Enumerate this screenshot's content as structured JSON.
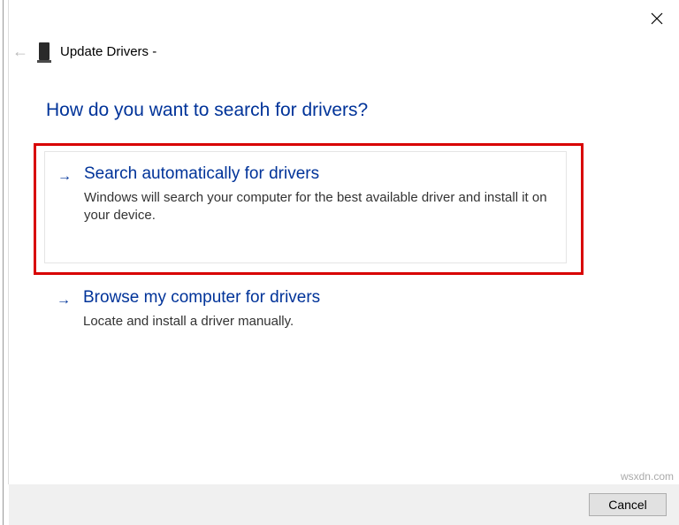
{
  "header": {
    "title": "Update Drivers -"
  },
  "prompt": "How do you want to search for drivers?",
  "options": [
    {
      "title": "Search automatically for drivers",
      "description": "Windows will search your computer for the best available driver and install it on your device."
    },
    {
      "title": "Browse my computer for drivers",
      "description": "Locate and install a driver manually."
    }
  ],
  "footer": {
    "cancel_label": "Cancel"
  },
  "watermark": "wsxdn.com"
}
